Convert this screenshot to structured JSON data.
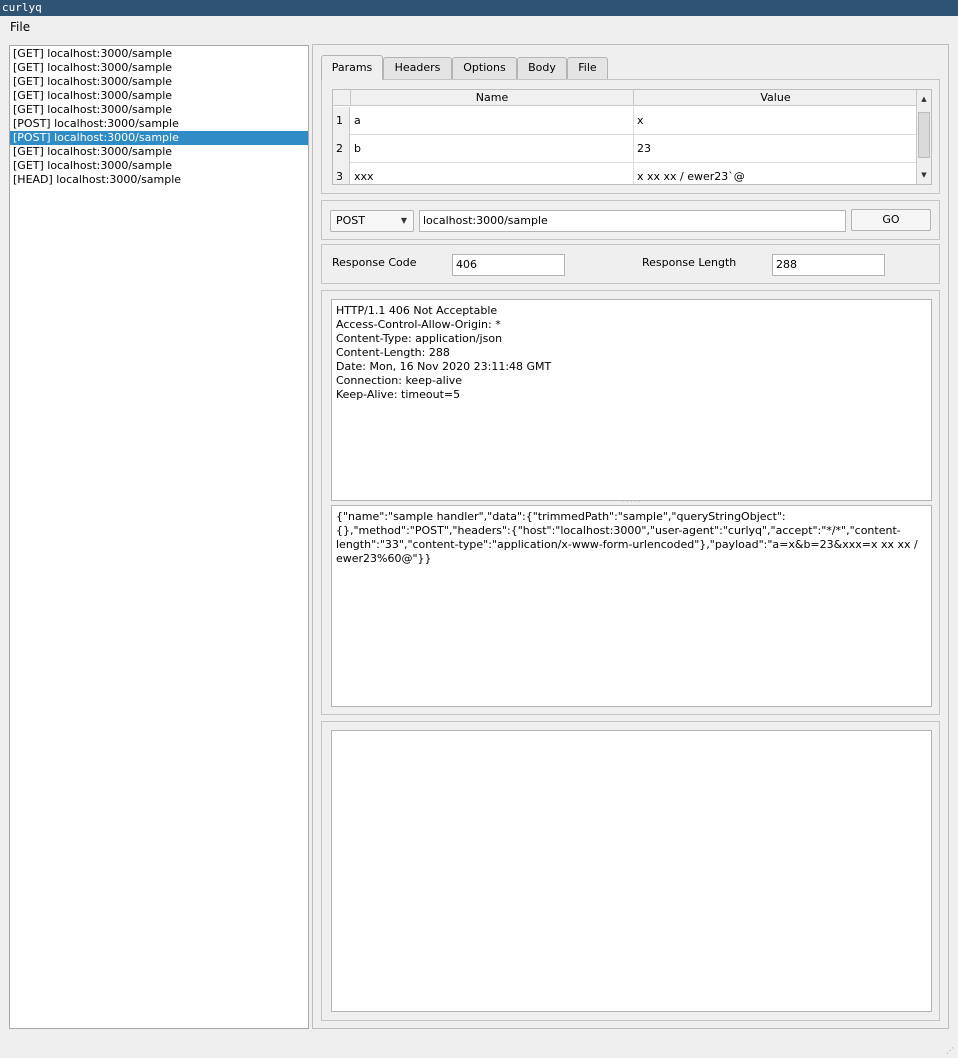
{
  "window": {
    "title": "curlyq"
  },
  "menu": {
    "file": "File"
  },
  "history": [
    {
      "label": "[GET] localhost:3000/sample",
      "selected": false
    },
    {
      "label": "[GET] localhost:3000/sample",
      "selected": false
    },
    {
      "label": "[GET] localhost:3000/sample",
      "selected": false
    },
    {
      "label": "[GET] localhost:3000/sample",
      "selected": false
    },
    {
      "label": "[GET] localhost:3000/sample",
      "selected": false
    },
    {
      "label": "[POST] localhost:3000/sample",
      "selected": false
    },
    {
      "label": "[POST] localhost:3000/sample",
      "selected": true
    },
    {
      "label": "[GET] localhost:3000/sample",
      "selected": false
    },
    {
      "label": "[GET] localhost:3000/sample",
      "selected": false
    },
    {
      "label": "[HEAD] localhost:3000/sample",
      "selected": false
    }
  ],
  "tabs": [
    {
      "label": "Params",
      "active": true
    },
    {
      "label": "Headers",
      "active": false
    },
    {
      "label": "Options",
      "active": false
    },
    {
      "label": "Body",
      "active": false
    },
    {
      "label": "File",
      "active": false
    }
  ],
  "params": {
    "headers": {
      "name": "Name",
      "value": "Value"
    },
    "rows": [
      {
        "num": "1",
        "name": "a",
        "value": "x"
      },
      {
        "num": "2",
        "name": "b",
        "value": "23"
      },
      {
        "num": "3",
        "name": "xxx",
        "value": "x xx xx / ewer23`@"
      }
    ],
    "scroll_up": "▲",
    "scroll_down": "▼"
  },
  "request": {
    "method": "POST",
    "url": "localhost:3000/sample",
    "go_label": "GO"
  },
  "response": {
    "code_label": "Response Code",
    "code_value": "406",
    "length_label": "Response Length",
    "length_value": "288",
    "headers_text": "HTTP/1.1 406 Not Acceptable\nAccess-Control-Allow-Origin: *\nContent-Type: application/json\nContent-Length: 288\nDate: Mon, 16 Nov 2020 23:11:48 GMT\nConnection: keep-alive\nKeep-Alive: timeout=5",
    "body_text": "{\"name\":\"sample handler\",\"data\":{\"trimmedPath\":\"sample\",\"queryStringObject\":\n{},\"method\":\"POST\",\"headers\":{\"host\":\"localhost:3000\",\"user-agent\":\"curlyq\",\"accept\":\"*/*\",\"content-\nlength\":\"33\",\"content-type\":\"application/x-www-form-urlencoded\"},\"payload\":\"a=x&b=23&xxx=x xx xx /\newer23%60@\"}}",
    "extra_text": ""
  },
  "icons": {
    "dropdown": "chevron-down-icon",
    "grip": "resize-grip-icon"
  },
  "colors": {
    "titlebar": "#2f5373",
    "selection": "#308cc6"
  }
}
